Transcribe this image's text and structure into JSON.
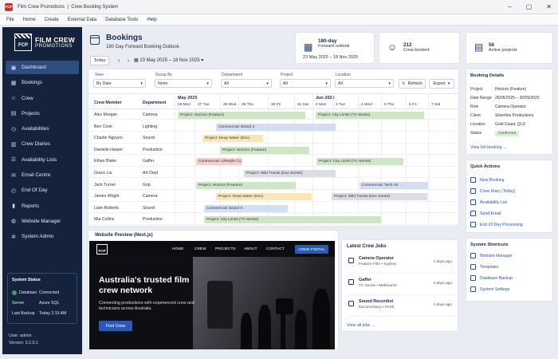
{
  "window": {
    "app_title": "Film Crew Promotions",
    "subtitle": "Crew Booking System",
    "icon_text": "FCP"
  },
  "menu": [
    "File",
    "Home",
    "Create",
    "External Data",
    "Database Tools",
    "Help"
  ],
  "sidebar": {
    "logo_box": "FCP",
    "logo_line1": "FILM CREW",
    "logo_line2": "PROMOTIONS",
    "items": [
      {
        "label": "Dashboard",
        "icon": "dashboard-icon",
        "glyph": "▣",
        "active": true
      },
      {
        "label": "Bookings",
        "icon": "calendar-icon",
        "glyph": "▦"
      },
      {
        "label": "Crew",
        "icon": "people-icon",
        "glyph": "☺"
      },
      {
        "label": "Projects",
        "icon": "briefcase-icon",
        "glyph": "▤"
      },
      {
        "label": "Availabilities",
        "icon": "clock-icon",
        "glyph": "◷"
      },
      {
        "label": "Crew Diaries",
        "icon": "book-icon",
        "glyph": "▥"
      },
      {
        "label": "Availability Lists",
        "icon": "list-icon",
        "glyph": "☰"
      },
      {
        "label": "Email Centre",
        "icon": "mail-icon",
        "glyph": "✉"
      },
      {
        "label": "End Of Day",
        "icon": "time-icon",
        "glyph": "◴"
      },
      {
        "label": "Reports",
        "icon": "bar-chart-icon",
        "glyph": "▮"
      },
      {
        "label": "Website Manager",
        "icon": "globe-icon",
        "glyph": "◍"
      },
      {
        "label": "System Admin",
        "icon": "gear-icon",
        "glyph": "✲"
      }
    ],
    "status": {
      "title": "System Status",
      "database_label": "Database",
      "database_value": "Connected",
      "server_label": "Server",
      "server_value": "Azure SQL",
      "backup_label": "Last Backup",
      "backup_value": "Today 2:15 AM"
    },
    "user": "User: admin",
    "version": "Version: 3.2.0.1"
  },
  "header": {
    "title": "Bookings",
    "subtitle": "180 Day Forward Booking Outlook",
    "today_label": "Today",
    "date_range": "23 May 2025 – 18 Nov 2025"
  },
  "stats": [
    {
      "value": "180-day",
      "label": "Forward outlook",
      "extra": "23 May 2025 – 18 Nov 2025",
      "icon": "calendar-icon"
    },
    {
      "value": "212",
      "label": "Crew booked",
      "icon": "people-icon"
    },
    {
      "value": "56",
      "label": "Active projects",
      "icon": "clipboard-icon"
    }
  ],
  "filters": {
    "view_label": "View",
    "view_value": "By Date",
    "group_label": "Group By",
    "group_value": "None",
    "dept_label": "Department",
    "dept_value": "All",
    "project_label": "Project",
    "project_value": "All",
    "location_label": "Location",
    "location_value": "All",
    "refresh_label": "Refresh",
    "export_label": "Export"
  },
  "gantt": {
    "col_member": "Crew Member",
    "col_department": "Department",
    "months": [
      "May 2025",
      "Jun 2025"
    ],
    "days": [
      "26 Mon",
      "27 Tue",
      "28 Wed",
      "29 Thu",
      "30 Fri",
      "31 Sat",
      "2 Mon",
      "3 Tue",
      "4 Wed",
      "5 Thu",
      "6 Fri",
      "7 Sat"
    ],
    "rows": [
      {
        "name": "Alex Morgan",
        "dept": "Camera"
      },
      {
        "name": "Ben Cook",
        "dept": "Lighting"
      },
      {
        "name": "Charlie Nguyen",
        "dept": "Sound"
      },
      {
        "name": "Danielle Harper",
        "dept": "Production"
      },
      {
        "name": "Ethan Blake",
        "dept": "Gaffer"
      },
      {
        "name": "Grace Liu",
        "dept": "Art Dept"
      },
      {
        "name": "Jack Turner",
        "dept": "Grip"
      },
      {
        "name": "James Wright",
        "dept": "Camera"
      },
      {
        "name": "Liam Roberts",
        "dept": "Sound"
      },
      {
        "name": "Mia Collins",
        "dept": "Production"
      }
    ],
    "bars": [
      {
        "label": "Project: Horizon (Feature)",
        "color": "green"
      },
      {
        "label": "Project: City Limits (TV Series)",
        "color": "green"
      },
      {
        "label": "Commercial: Brand X",
        "color": "blue"
      },
      {
        "label": "Project: Deep Water (Doc)",
        "color": "yellow"
      },
      {
        "label": "Project: Horizon (Feature)",
        "color": "green"
      },
      {
        "label": "Commercial: Lifestyle Co.",
        "color": "red"
      },
      {
        "label": "Project: City Limits (TV Series)",
        "color": "green"
      },
      {
        "label": "Project: Wild Tracks (Doc Series)",
        "color": "gray"
      },
      {
        "label": "Project: Horizon (Feature)",
        "color": "green"
      },
      {
        "label": "Commercial: Tech Ad",
        "color": "blue"
      },
      {
        "label": "Project: Deep Water (Doc)",
        "color": "yellow"
      },
      {
        "label": "Project: Wild Tracks (Doc Series)",
        "color": "gray"
      },
      {
        "label": "Commercial: Brand X",
        "color": "blue"
      },
      {
        "label": "Project: City Limits (TV Series)",
        "color": "green"
      }
    ]
  },
  "booking_details": {
    "title": "Booking Details",
    "project_label": "Project",
    "project_value": "Horizon (Feature)",
    "range_label": "Date Range",
    "range_value": "26/05/2025 – 30/05/2025",
    "role_label": "Role",
    "role_value": "Camera Operator",
    "client_label": "Client",
    "client_value": "Silverline Productions",
    "location_label": "Location",
    "location_value": "Gold Coast, QLD",
    "status_label": "Status",
    "status_value": "Confirmed",
    "link": "View full booking →"
  },
  "quick_actions": {
    "title": "Quick Actions",
    "items": [
      "New Booking",
      "Crew Diary (Today)",
      "Availability List",
      "Send Email",
      "End Of Day Processing"
    ]
  },
  "shortcuts": {
    "title": "System Shortcuts",
    "items": [
      "Website Manager",
      "Templates",
      "Database Backup",
      "System Settings"
    ]
  },
  "preview": {
    "title": "Website Preview (Next.js)",
    "logo": "FCP",
    "nav": [
      "HOME",
      "CREW",
      "PROJECTS",
      "ABOUT",
      "CONTACT"
    ],
    "portal": "CREW PORTAL",
    "hero_title": "Australia's trusted film crew network",
    "hero_sub": "Connecting productions with experienced crew and technicians across Australia.",
    "hero_btn": "Find Crew"
  },
  "jobs": {
    "title": "Latest Crew Jobs",
    "items": [
      {
        "title": "Camera Operator",
        "sub": "Feature Film • Sydney",
        "ago": "2 days ago"
      },
      {
        "title": "Gaffer",
        "sub": "TV Series • Melbourne",
        "ago": "3 days ago"
      },
      {
        "title": "Sound Recordist",
        "sub": "Documentary • Perth",
        "ago": "4 days ago"
      }
    ],
    "link": "View all jobs →"
  }
}
